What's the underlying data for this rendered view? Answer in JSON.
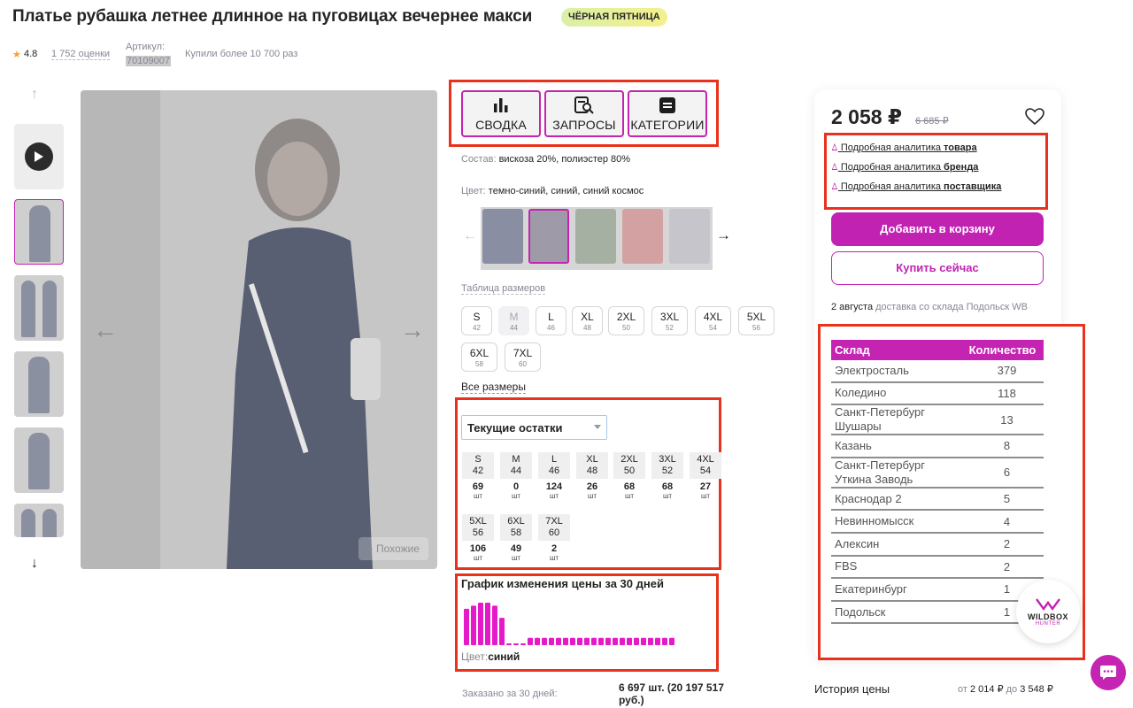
{
  "product": {
    "title": "Платье рубашка летнее длинное на пуговицах вечернее макси",
    "promo_badge": "ЧЁРНАЯ ПЯТНИЦА",
    "rating": "4.8",
    "reviews": "1 752 оценки",
    "article_label": "Артикул:",
    "article": "70109007",
    "bought": "Купили более 10 700 раз",
    "similar_label": "Похожие"
  },
  "tabs": [
    {
      "label": "СВОДКА",
      "icon": "bar-chart-icon"
    },
    {
      "label": "ЗАПРОСЫ",
      "icon": "search-doc-icon"
    },
    {
      "label": "КАТЕГОРИИ",
      "icon": "list-icon"
    }
  ],
  "details": {
    "composition_label": "Состав:",
    "composition": "вискоза 20%, полиэстер 80%",
    "color_label": "Цвет:",
    "color": "темно-синий, синий, синий космос",
    "size_table_link": "Таблица размеров",
    "all_sizes_link": "Все размеры"
  },
  "sizes": [
    {
      "size": "S",
      "num": "42",
      "available": true
    },
    {
      "size": "M",
      "num": "44",
      "available": false
    },
    {
      "size": "L",
      "num": "46",
      "available": true
    },
    {
      "size": "XL",
      "num": "48",
      "available": true
    },
    {
      "size": "2XL",
      "num": "50",
      "available": true
    },
    {
      "size": "3XL",
      "num": "52",
      "available": true
    },
    {
      "size": "4XL",
      "num": "54",
      "available": true
    },
    {
      "size": "5XL",
      "num": "56",
      "available": true
    },
    {
      "size": "6XL",
      "num": "58",
      "available": true
    },
    {
      "size": "7XL",
      "num": "60",
      "available": true
    }
  ],
  "stock": {
    "select_value": "Текущие остатки",
    "unit": "шт",
    "items": [
      {
        "size": "S",
        "num": "42",
        "qty": "69"
      },
      {
        "size": "M",
        "num": "44",
        "qty": "0"
      },
      {
        "size": "L",
        "num": "46",
        "qty": "124"
      },
      {
        "size": "XL",
        "num": "48",
        "qty": "26"
      },
      {
        "size": "2XL",
        "num": "50",
        "qty": "68"
      },
      {
        "size": "3XL",
        "num": "52",
        "qty": "68"
      },
      {
        "size": "4XL",
        "num": "54",
        "qty": "27"
      },
      {
        "size": "5XL",
        "num": "56",
        "qty": "106"
      },
      {
        "size": "6XL",
        "num": "58",
        "qty": "49"
      },
      {
        "size": "7XL",
        "num": "60",
        "qty": "2"
      }
    ]
  },
  "chart_data": {
    "type": "bar",
    "title": "График изменения цены за 30 дней",
    "caption_label": "Цвет:",
    "caption_value": "синий",
    "values": [
      6,
      6.5,
      7,
      7,
      6.5,
      4.5,
      0.3,
      0.3,
      0.3,
      1.2,
      1.2,
      1.2,
      1.2,
      1.2,
      1.2,
      1.2,
      1.2,
      1.2,
      1.2,
      1.2,
      1.2,
      1.2,
      1.2,
      1.2,
      1.2,
      1.2,
      1.2,
      1.2,
      1.2,
      1.2
    ],
    "color": "#e619c8"
  },
  "orders": {
    "label": "Заказано за 30 дней:",
    "value": "6 697 шт. (20 197 517 руб.)"
  },
  "buy": {
    "price": "2 058 ₽",
    "old_price": "6 685 ₽",
    "links": [
      {
        "prefix": " Подробная аналитика ",
        "bold": "товара"
      },
      {
        "prefix": " Подробная аналитика ",
        "bold": "бренда"
      },
      {
        "prefix": " Подробная аналитика ",
        "bold": "поставщика"
      }
    ],
    "cart_button": "Добавить в корзину",
    "buy_button": "Купить сейчас",
    "delivery_date": "2 августа",
    "delivery_text": "доставка со склада Подольск WB"
  },
  "warehouses": {
    "col_name": "Склад",
    "col_qty": "Количество",
    "rows": [
      {
        "name": "Электросталь",
        "qty": "379"
      },
      {
        "name": "Коледино",
        "qty": "118"
      },
      {
        "name": "Санкт-Петербург Шушары",
        "qty": "13"
      },
      {
        "name": "Казань",
        "qty": "8"
      },
      {
        "name": "Санкт-Петербург Уткина Заводь",
        "qty": "6"
      },
      {
        "name": "Краснодар 2",
        "qty": "5"
      },
      {
        "name": "Невинномысск",
        "qty": "4"
      },
      {
        "name": "Алексин",
        "qty": "2"
      },
      {
        "name": "FBS",
        "qty": "2"
      },
      {
        "name": "Екатеринбург",
        "qty": "1"
      },
      {
        "name": "Подольск",
        "qty": "1"
      }
    ]
  },
  "wildbox": {
    "line1": "WILDBOX",
    "line2": "HUNTER"
  },
  "price_history": {
    "label": "История цены",
    "from_label": "от",
    "from": "2 014 ₽",
    "to_label": "до",
    "to": "3 548 ₽"
  },
  "colors": {
    "accent": "#c424b1",
    "highlight": "#e8321b",
    "bar": "#e619c8"
  }
}
